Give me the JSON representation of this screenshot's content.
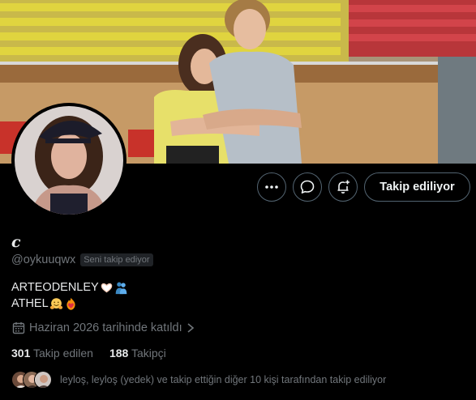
{
  "profile": {
    "display_name": "c",
    "handle": "@oykuuqwx",
    "follows_you_badge": "Seni takip ediyor",
    "bio_line1": "ARTEODENLEY",
    "bio_line2": "ATHEL",
    "joined": "Haziran 2026 tarihinde katıldı"
  },
  "actions": {
    "follow_label": "Takip ediliyor"
  },
  "stats": {
    "following_count": "301",
    "following_label": "Takip edilen",
    "followers_count": "188",
    "followers_label": "Takipçi"
  },
  "followed_by": {
    "text": "leyloş, leyloş (yedek) ve takip ettiğin diğer 10 kişi tarafından takip ediliyor"
  },
  "icons": {
    "more": "more-horizontal-icon",
    "message": "message-icon",
    "notify": "bell-plus-icon",
    "calendar": "calendar-icon",
    "chevron": "chevron-right-icon"
  },
  "colors": {
    "background": "#000000",
    "text_primary": "#e7e9ea",
    "text_secondary": "#71767b",
    "border": "#536471"
  }
}
